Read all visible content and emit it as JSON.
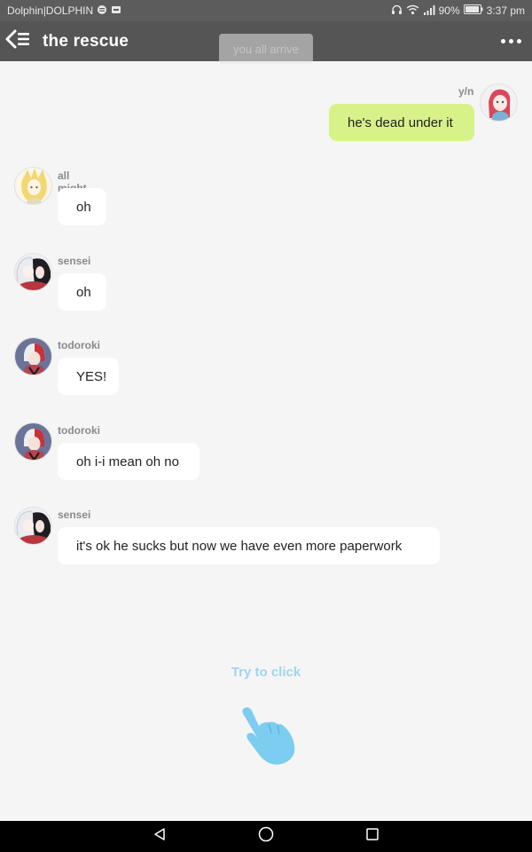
{
  "status_bar": {
    "carrier": "Dolphin|DOLPHIN",
    "battery": "90%",
    "time": "3:37 pm"
  },
  "header": {
    "title": "the rescue",
    "faded_banner": "you all arrive"
  },
  "messages": [
    {
      "sender": "y/n",
      "text": "he's dead under it",
      "mine": true
    },
    {
      "sender": "all might",
      "text": "oh"
    },
    {
      "sender": "sensei",
      "text": "oh"
    },
    {
      "sender": "todoroki",
      "text": "YES!"
    },
    {
      "sender": "todoroki",
      "text": "oh i-i mean oh no"
    },
    {
      "sender": "sensei",
      "text": "it's ok he sucks but now we have even more paperwork"
    }
  ],
  "prompt": {
    "label": "Try to click"
  },
  "colors": {
    "header_bg": "#555555",
    "my_bubble": "#d8f28a",
    "other_bubble": "#ffffff",
    "prompt": "#9fd4f0"
  },
  "icons": {
    "back": "back-arrow-menu-icon",
    "more": "more-dots-icon",
    "hand": "pointing-hand-icon",
    "nav_back": "triangle-back-icon",
    "nav_home": "circle-home-icon",
    "nav_recent": "square-recent-icon"
  }
}
